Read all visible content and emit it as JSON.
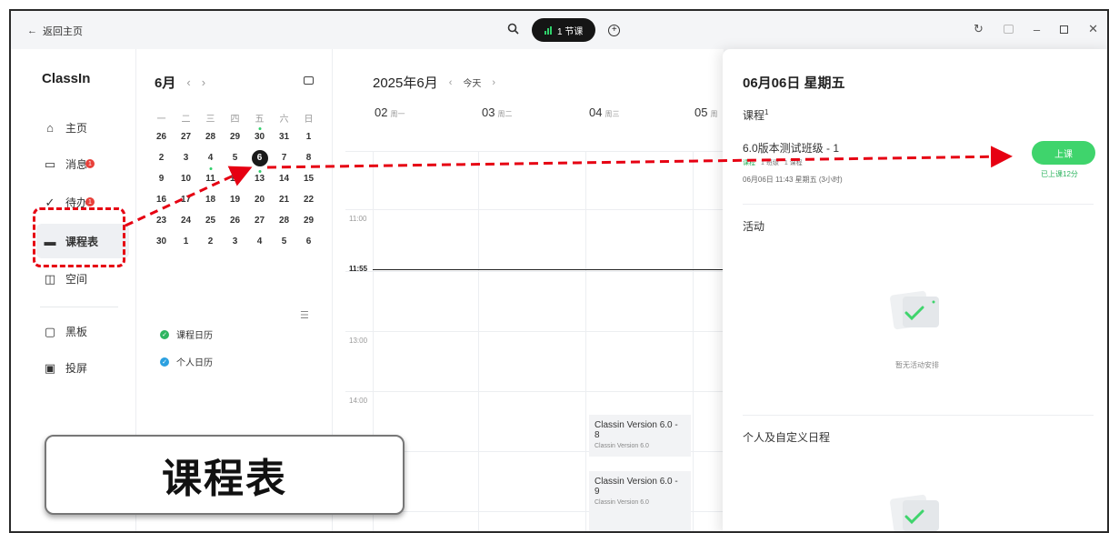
{
  "topbar": {
    "back_label": "返回主页",
    "lesson_pill": "1 节课",
    "icons": [
      "search-icon",
      "add-circle-icon",
      "refresh-icon",
      "sidebar-icon",
      "minimize-icon",
      "maximize-icon",
      "close-icon"
    ]
  },
  "nav": {
    "logo": "ClassIn",
    "items": [
      {
        "label": "主页",
        "icon": "home-icon"
      },
      {
        "label": "消息",
        "icon": "message-icon",
        "badge": "1"
      },
      {
        "label": "待办",
        "icon": "todo-icon",
        "badge": "1"
      },
      {
        "label": "课程表",
        "icon": "calendar-icon",
        "active": true
      },
      {
        "label": "空间",
        "icon": "space-icon"
      },
      {
        "label": "黑板",
        "icon": "blackboard-icon"
      },
      {
        "label": "投屏",
        "icon": "screen-cast-icon"
      }
    ]
  },
  "mini_calendar": {
    "month": "6月",
    "weekdays": [
      "一",
      "二",
      "三",
      "四",
      "五",
      "六",
      "日"
    ],
    "weeks": [
      [
        "26",
        "27",
        "28",
        "29",
        "30",
        "31",
        "1"
      ],
      [
        "2",
        "3",
        "4",
        "5",
        "6",
        "7",
        "8"
      ],
      [
        "9",
        "10",
        "11",
        "12",
        "13",
        "14",
        "15"
      ],
      [
        "16",
        "17",
        "18",
        "19",
        "20",
        "21",
        "22"
      ],
      [
        "23",
        "24",
        "25",
        "26",
        "27",
        "28",
        "29"
      ],
      [
        "30",
        "1",
        "2",
        "3",
        "4",
        "5",
        "6"
      ]
    ],
    "today": "6",
    "calendars": [
      {
        "label": "课程日历",
        "color": "#2fb560"
      },
      {
        "label": "个人日历",
        "color": "#2ba0e0"
      }
    ]
  },
  "main_calendar": {
    "title": "2025年6月",
    "today_label": "今天",
    "days": [
      {
        "num": "02",
        "name": "周一"
      },
      {
        "num": "03",
        "name": "周二"
      },
      {
        "num": "04",
        "name": "周三"
      },
      {
        "num": "05",
        "name": "周"
      }
    ],
    "times": [
      "11:00",
      "11:55",
      "13:00",
      "14:00"
    ],
    "events": [
      {
        "title": "Classin Version 6.0 - 8",
        "sub": "Classin Version 6.0"
      },
      {
        "title": "Classin Version 6.0 - 9",
        "sub": "Classin Version 6.0"
      }
    ]
  },
  "panel": {
    "title": "06月06日 星期五",
    "course_section": "课程",
    "course_count": "1",
    "course_name": "6.0版本测试班级 - 1",
    "course_tags": [
      "课程",
      "1 班级",
      "1 课程"
    ],
    "course_time": "06月06日 11:43 星期五 (3小时)",
    "join_label": "上课",
    "since_label": "已上课12分",
    "activity_section": "活动",
    "empty_text": "暂无活动安排",
    "personal_section": "个人及自定义日程"
  },
  "callout": {
    "text": "课程表"
  },
  "colors": {
    "accent_green": "#3fd46c",
    "highlight_red": "#e60012",
    "badge_red": "#e8403a"
  }
}
